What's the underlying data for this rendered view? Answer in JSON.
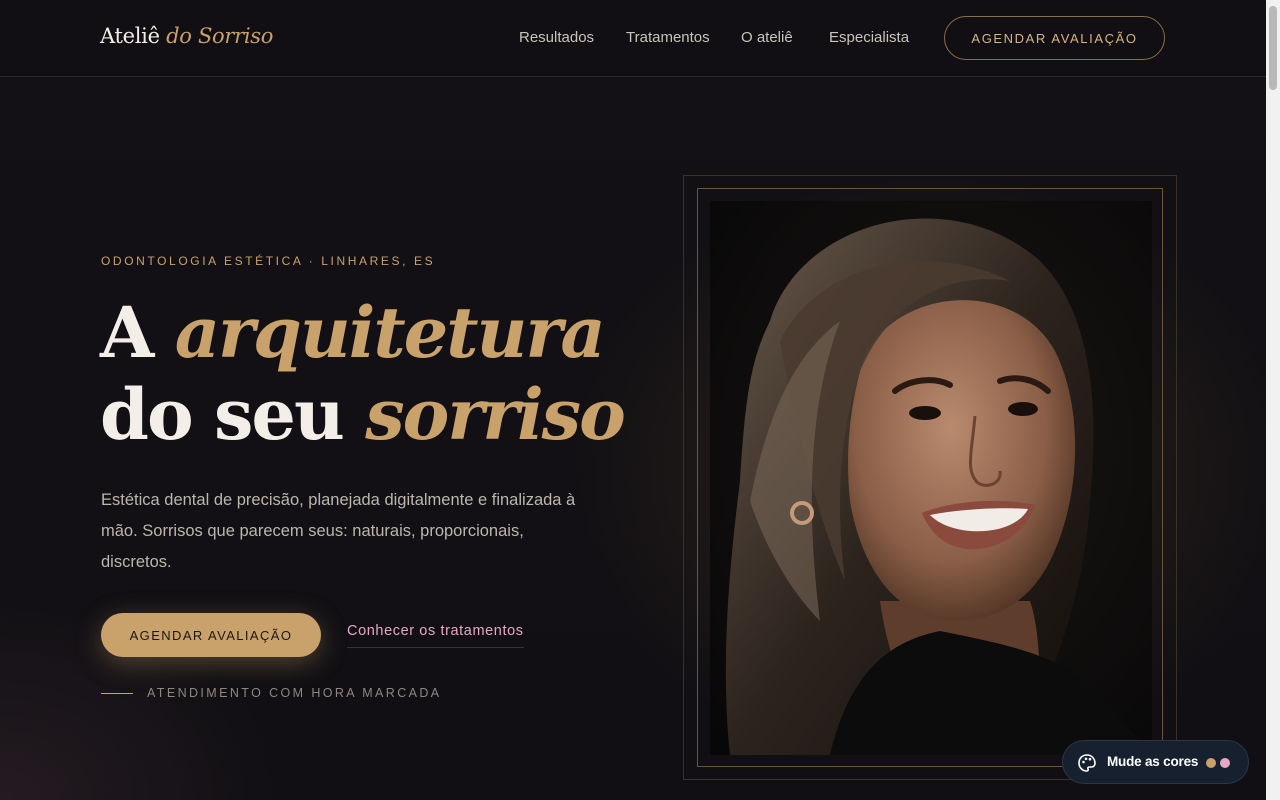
{
  "header": {
    "logo_part1": "Ateliê ",
    "logo_part2": "do Sorriso",
    "nav": [
      {
        "label": "Resultados"
      },
      {
        "label": "Tratamentos"
      },
      {
        "label": "O ateliê"
      },
      {
        "label": "Especialista"
      }
    ],
    "cta_label": "AGENDAR AVALIAÇÃO"
  },
  "hero": {
    "eyebrow": "ODONTOLOGIA ESTÉTICA · LINHARES, ES",
    "headline": {
      "line1_plain": "A ",
      "line1_accent": "arquitetura",
      "line2_plain": "do seu ",
      "line2_accent": "sorriso"
    },
    "lead": "Estética dental de precisão, planejada digitalmente e finalizada à mão. Sorrisos que parecem seus: naturais, proporcionais, discretos.",
    "primary_cta": "AGENDAR AVALIAÇÃO",
    "secondary_cta": "Conhecer os tratamentos",
    "appointment_note": "ATENDIMENTO COM HORA MARCADA"
  },
  "portrait": {
    "icon": "portrait-photo"
  },
  "theme_switcher": {
    "label": "Mude as cores",
    "icon": "palette-icon",
    "swatches": [
      "#c9a26b",
      "#e6a8c4"
    ]
  },
  "colors": {
    "background": "#121014",
    "accent_gold": "#c9a26b",
    "accent_pink": "#e6a8c4",
    "text_light": "#f3eee7"
  }
}
